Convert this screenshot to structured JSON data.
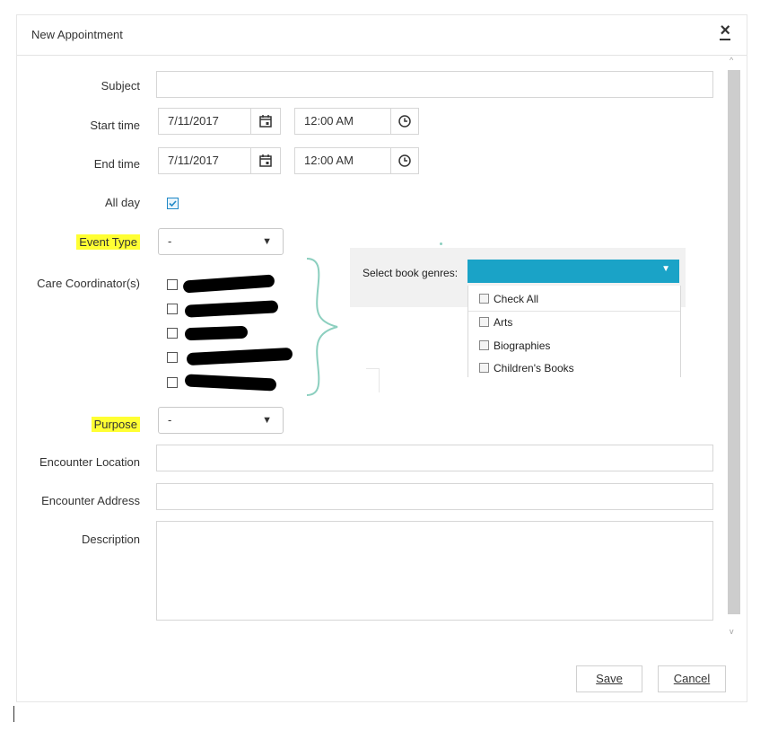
{
  "dialog": {
    "title": "New Appointment",
    "close_label": "×"
  },
  "form": {
    "subject_label": "Subject",
    "subject_value": "",
    "start_label": "Start time",
    "start_date": "7/11/2017",
    "start_time": "12:00 AM",
    "end_label": "End time",
    "end_date": "7/11/2017",
    "end_time": "12:00 AM",
    "allday_label": "All day",
    "event_type_label": "Event Type",
    "event_type_value": "-",
    "coordinators_label": "Care Coordinator(s)",
    "purpose_label": "Purpose",
    "purpose_value": "-",
    "location_label": "Encounter Location",
    "address_label": "Encounter Address",
    "description_label": "Description"
  },
  "genres": {
    "label": "Select book genres:",
    "items": [
      "Check All",
      "Arts",
      "Biographies",
      "Children's Books"
    ]
  },
  "footer": {
    "save_label": "Save",
    "cancel_label": "Cancel"
  },
  "colors": {
    "accent": "#1aa3c7",
    "highlight": "#ffff33",
    "brace": "#8ccfbf"
  }
}
